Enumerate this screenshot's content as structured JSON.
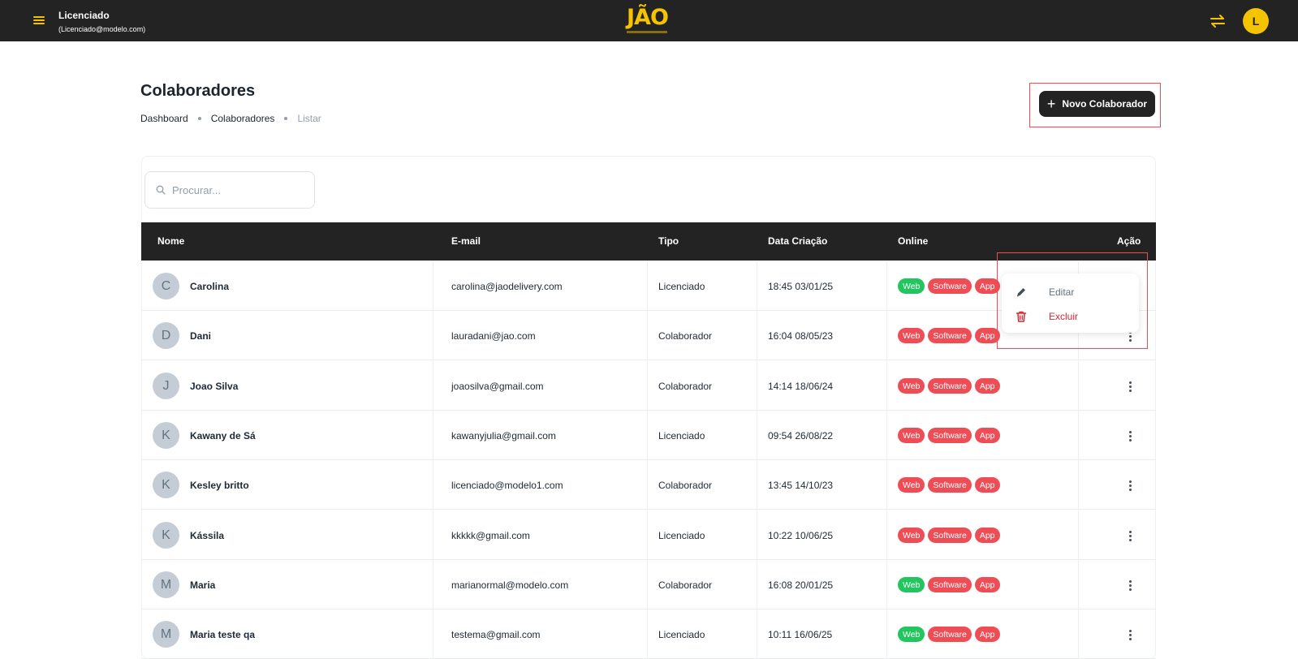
{
  "header": {
    "user_name": "Licenciado",
    "user_email": "(Licenciado@modelo.com)",
    "logo_text": "JÃO",
    "avatar_letter": "L",
    "accent_color": "#f5c400"
  },
  "page": {
    "title": "Colaboradores",
    "breadcrumb": [
      "Dashboard",
      "Colaboradores",
      "Listar"
    ],
    "new_button_label": "Novo Colaborador"
  },
  "search": {
    "placeholder": "Procurar..."
  },
  "table": {
    "headers": [
      "Nome",
      "E-mail",
      "Tipo",
      "Data Criação",
      "Online",
      "Ação"
    ],
    "rows": [
      {
        "initial": "C",
        "name": "Carolina",
        "email": "carolina@jaodelivery.com",
        "tipo": "Licenciado",
        "data": "18:45 03/01/25",
        "web_online": true
      },
      {
        "initial": "D",
        "name": "Dani",
        "email": "lauradani@jao.com",
        "tipo": "Colaborador",
        "data": "16:04 08/05/23",
        "web_online": false
      },
      {
        "initial": "J",
        "name": "Joao Silva",
        "email": "joaosilva@gmail.com",
        "tipo": "Colaborador",
        "data": "14:14 18/06/24",
        "web_online": false
      },
      {
        "initial": "K",
        "name": "Kawany de Sá",
        "email": "kawanyjulia@gmail.com",
        "tipo": "Licenciado",
        "data": "09:54 26/08/22",
        "web_online": false
      },
      {
        "initial": "K",
        "name": "Kesley britto",
        "email": "licenciado@modelo1.com",
        "tipo": "Colaborador",
        "data": "13:45 14/10/23",
        "web_online": false
      },
      {
        "initial": "K",
        "name": "Kássila",
        "email": "kkkkk@gmail.com",
        "tipo": "Licenciado",
        "data": "10:22 10/06/25",
        "web_online": false
      },
      {
        "initial": "M",
        "name": "Maria",
        "email": "marianormal@modelo.com",
        "tipo": "Colaborador",
        "data": "16:08 20/01/25",
        "web_online": true
      },
      {
        "initial": "M",
        "name": "Maria teste qa",
        "email": "testema@gmail.com",
        "tipo": "Licenciado",
        "data": "10:11 16/06/25",
        "web_online": true
      }
    ],
    "badges": [
      "Web",
      "Software",
      "App"
    ]
  },
  "action_menu": {
    "edit_label": "Editar",
    "delete_label": "Excluir"
  }
}
